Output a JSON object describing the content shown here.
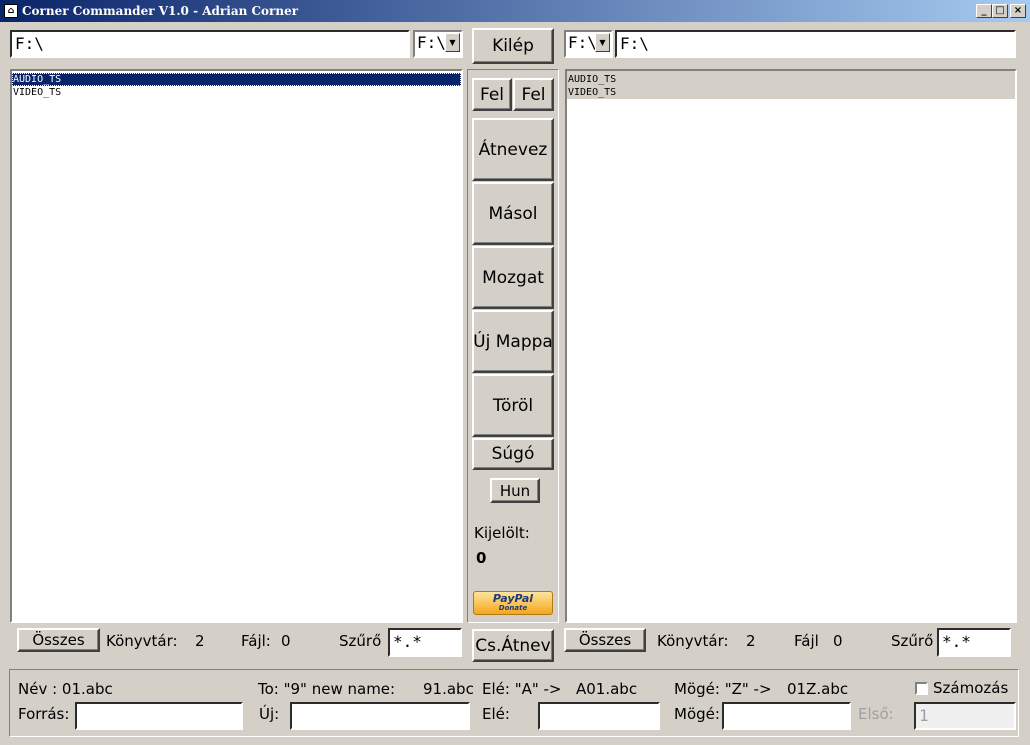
{
  "window": {
    "title": "Corner Commander V1.0 - Adrian Corner",
    "controls": [
      "_",
      "□",
      "×"
    ]
  },
  "left": {
    "path": "F:\\",
    "drive": "F:\\",
    "items": [
      "AUDIO_TS",
      "VIDEO_TS"
    ],
    "selected_index": 0,
    "all_button": "Összes",
    "dir_label": "Könyvtár:",
    "dir_count": "2",
    "file_label": "Fájl:",
    "file_count": "0",
    "filter_label": "Szűrő",
    "filter_value": "*.*"
  },
  "right": {
    "path": "F:\\",
    "drive": "F:\\",
    "items": [
      "AUDIO_TS",
      "VIDEO_TS"
    ],
    "all_button": "Összes",
    "dir_label": "Könyvtár:",
    "dir_count": "2",
    "file_label": "Fájl",
    "file_count": "0",
    "filter_label": "Szűrő",
    "filter_value": "*.*"
  },
  "middle": {
    "exit": "Kilép",
    "up_left": "Fel",
    "up_right": "Fel",
    "rename": "Átnevez",
    "copy": "Másol",
    "move": "Mozgat",
    "new_folder": "Új Mappa",
    "delete": "Töröl",
    "help": "Súgó",
    "lang": "Hun",
    "selected_label": "Kijelölt:",
    "selected_count": "0",
    "paypal": "PayPal",
    "paypal_sub": "Donate",
    "batch_rename": "Cs.Átnev"
  },
  "bottom": {
    "name_example": "Név : 01.abc",
    "to_example": "To: \"9\" new name:",
    "to_result": "91.abc",
    "prefix_example": "Elé: \"A\"  ->",
    "prefix_result": "A01.abc",
    "suffix_example": "Mögé: \"Z\"  ->",
    "suffix_result": "01Z.abc",
    "numbering_label": "Számozás",
    "source_label": "Forrás:",
    "source_value": "",
    "new_label": "Új:",
    "new_value": "",
    "prefix_label": "Elé:",
    "prefix_value": "",
    "suffix_label": "Mögé:",
    "suffix_value": "",
    "first_label": "Első:",
    "first_value": "1"
  },
  "icons": {
    "app": "app-icon",
    "dropdown": "dropdown-arrow-icon",
    "paypal": "paypal-donate-icon"
  }
}
